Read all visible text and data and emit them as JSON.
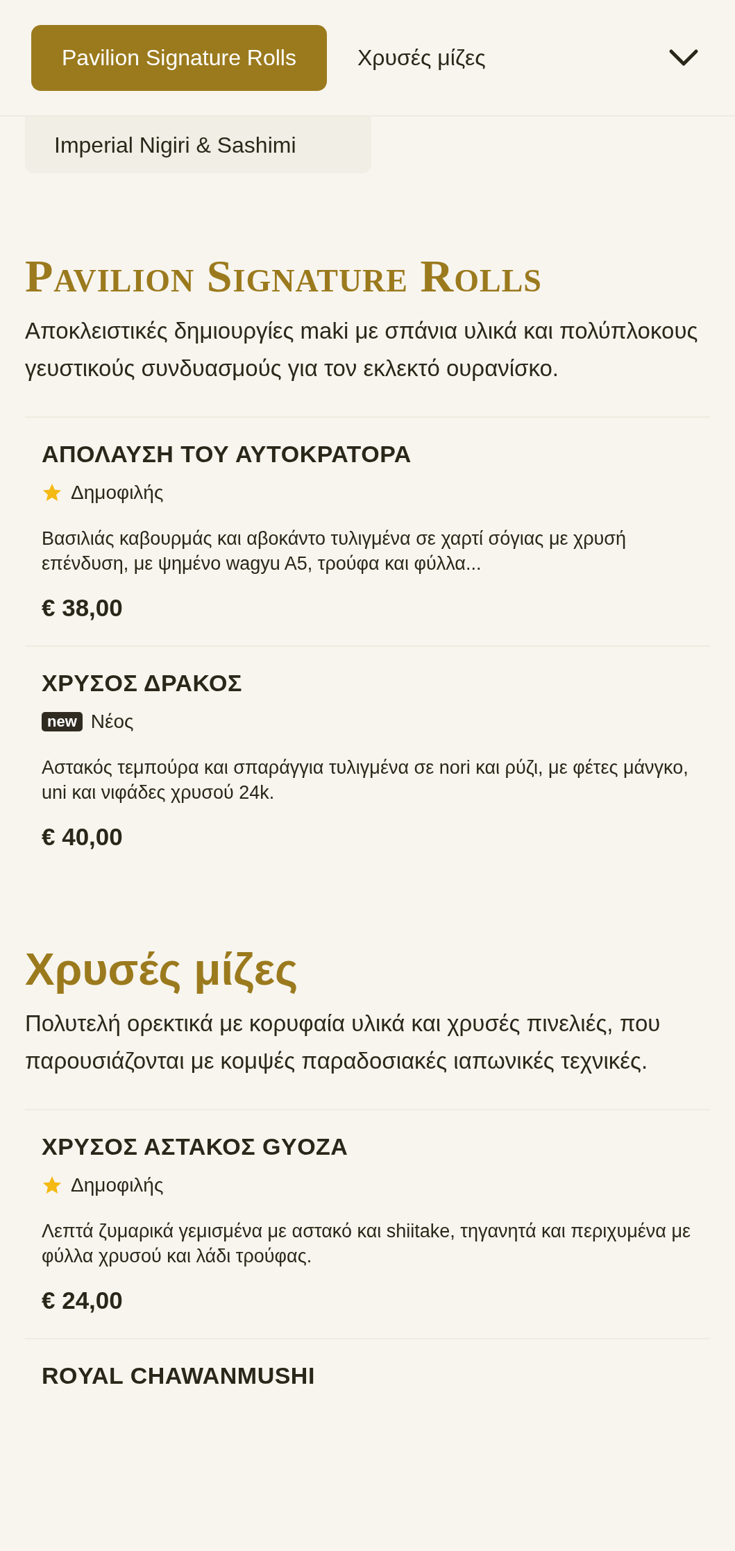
{
  "tabs": [
    {
      "label": "Pavilion Signature Rolls",
      "selected": true
    },
    {
      "label": "Χρυσές μίζες",
      "selected": false
    }
  ],
  "overflow_tabs": [
    {
      "label": "Imperial Nigiri & Sashimi",
      "selected": false
    }
  ],
  "sections": [
    {
      "title": "Pavilion Signature Rolls",
      "kind": "serif-caps",
      "description": "Αποκλειστικές δημιουργίες maki με σπάνια υλικά και πολύπλοκους γευστικούς συνδυασμούς για τον εκλεκτό ουρανίσκο.",
      "items": [
        {
          "name": "ΑΠΟΛΑΥΣΗ ΤΟΥ ΑΥΤΟΚΡΑΤΟΡΑ",
          "tag": {
            "kind": "popular",
            "label": "Δημοφιλής"
          },
          "description": "Βασιλιάς καβουρμάς και αβοκάντο τυλιγμένα σε χαρτί σόγιας με χρυσή επένδυση, με ψημένο wagyu A5, τρούφα και φύλλα...",
          "price": "€ 38,00"
        },
        {
          "name": "ΧΡΥΣΟΣ ΔΡΑΚΟΣ",
          "tag": {
            "kind": "new",
            "badge": "new",
            "label": "Νέος"
          },
          "description": "Αστακός τεμπούρα και σπαράγγια τυλιγμένα σε nori και ρύζι, με φέτες μάνγκο, uni και νιφάδες χρυσού 24k.",
          "price": "€ 40,00"
        }
      ]
    },
    {
      "title": "Χρυσές μίζες",
      "kind": "sans",
      "description": "Πολυτελή ορεκτικά με κορυφαία υλικά και χρυσές πινελιές, που παρουσιάζονται με κομψές παραδοσιακές ιαπωνικές τεχνικές.",
      "items": [
        {
          "name": "ΧΡΥΣΟΣ ΑΣΤΑΚΟΣ GYOZA",
          "tag": {
            "kind": "popular",
            "label": "Δημοφιλής"
          },
          "description": "Λεπτά ζυμαρικά γεμισμένα με αστακό και shiitake, τηγανητά και περιχυμένα με φύλλα χρυσού και λάδι τρούφας.",
          "price": "€ 24,00"
        },
        {
          "name": "ROYAL CHAWANMUSHI"
        }
      ]
    }
  ]
}
